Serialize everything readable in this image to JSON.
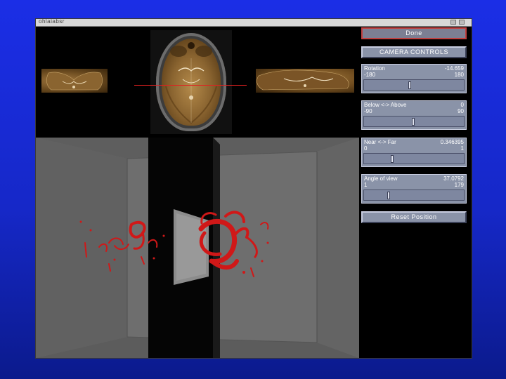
{
  "window": {
    "title": "ohlaiabsr",
    "title_icons": [
      "minimize-icon",
      "close-icon"
    ]
  },
  "viewer": {
    "brain_slices": [
      "coronal-slice",
      "axial-slice",
      "sagittal-slice"
    ],
    "slice_crosshair_color": "#e02020",
    "vessel_color": "#d01818"
  },
  "controls": {
    "done_label": "Done",
    "camera_label": "CAMERA CONTROLS",
    "rotation": {
      "label": "Rotation",
      "value": "-14.659",
      "min": "-180",
      "max": "180",
      "fraction": 0.46
    },
    "below_above": {
      "label": "Below <-> Above",
      "value": "0",
      "min": "-90",
      "max": "90",
      "fraction": 0.5
    },
    "near_far": {
      "label": "Near <-> Far",
      "value": "0.346395",
      "min": "0",
      "max": "1",
      "fraction": 0.28
    },
    "angle_of_view": {
      "label": "Angle of view",
      "value": "37.0792",
      "min": "1",
      "max": "179",
      "fraction": 0.24
    },
    "reset_label": "Reset Position"
  }
}
